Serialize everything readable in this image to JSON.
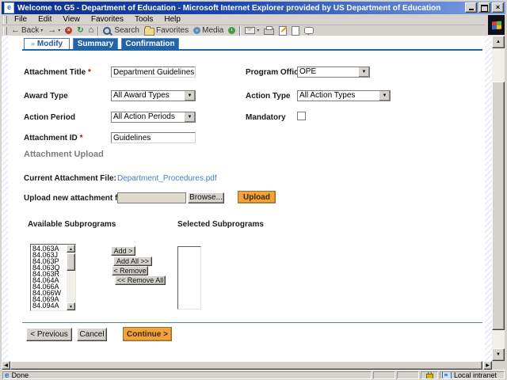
{
  "window": {
    "title": "Welcome to G5 - Department of Education - Microsoft Internet Explorer provided by US Department of Education"
  },
  "menu_bar": {
    "items": [
      "File",
      "Edit",
      "View",
      "Favorites",
      "Tools",
      "Help"
    ]
  },
  "toolbar": {
    "back_label": "Back",
    "search_label": "Search",
    "favorites_label": "Favorites",
    "media_label": "Media"
  },
  "tabs": [
    {
      "label": "Modify",
      "active": true
    },
    {
      "label": "Summary",
      "active": false
    },
    {
      "label": "Confirmation",
      "active": false
    }
  ],
  "form": {
    "required_marker": "*",
    "attachment_title": {
      "label": "Attachment Title",
      "value": "Department Guidelines",
      "required": true
    },
    "program_office": {
      "label": "Program Office",
      "value": "OPE"
    },
    "award_type": {
      "label": "Award Type",
      "value": "All Award Types"
    },
    "action_type": {
      "label": "Action Type",
      "value": "All Action Types"
    },
    "action_period": {
      "label": "Action Period",
      "value": "All Action Periods"
    },
    "mandatory": {
      "label": "Mandatory",
      "checked": false
    },
    "attachment_id": {
      "label": "Attachment ID",
      "value": "Guidelines",
      "required": true
    }
  },
  "upload_section": {
    "title": "Attachment Upload",
    "current_file_label": "Current Attachment File:",
    "current_file_name": "Department_Procedures.pdf",
    "new_file_label": "Upload new attachment file",
    "browse_button": "Browse...",
    "upload_button": "Upload"
  },
  "subprograms": {
    "available_label": "Available Subprograms",
    "selected_label": "Selected Subprograms",
    "available_items": [
      "84.063A",
      "84.063J",
      "84.063P",
      "84.063Q",
      "84.063R",
      "84.064A",
      "84.066A",
      "84.066W",
      "84.069A",
      "84.094A"
    ],
    "selected_items": [],
    "add_button": "Add >",
    "add_all_button": "Add All >>",
    "remove_button": "< Remove",
    "remove_all_button": "<< Remove All"
  },
  "footer": {
    "previous_button": "< Previous",
    "cancel_button": "Cancel",
    "continue_button": "Continue >"
  },
  "status_bar": {
    "status_text": "Done",
    "zone_text": "Local intranet"
  },
  "colors": {
    "accent_orange": "#F2A23C",
    "tab_blue": "#2264A8",
    "link_blue": "#4080C0",
    "titlebar_blue": "#0B2E91"
  }
}
